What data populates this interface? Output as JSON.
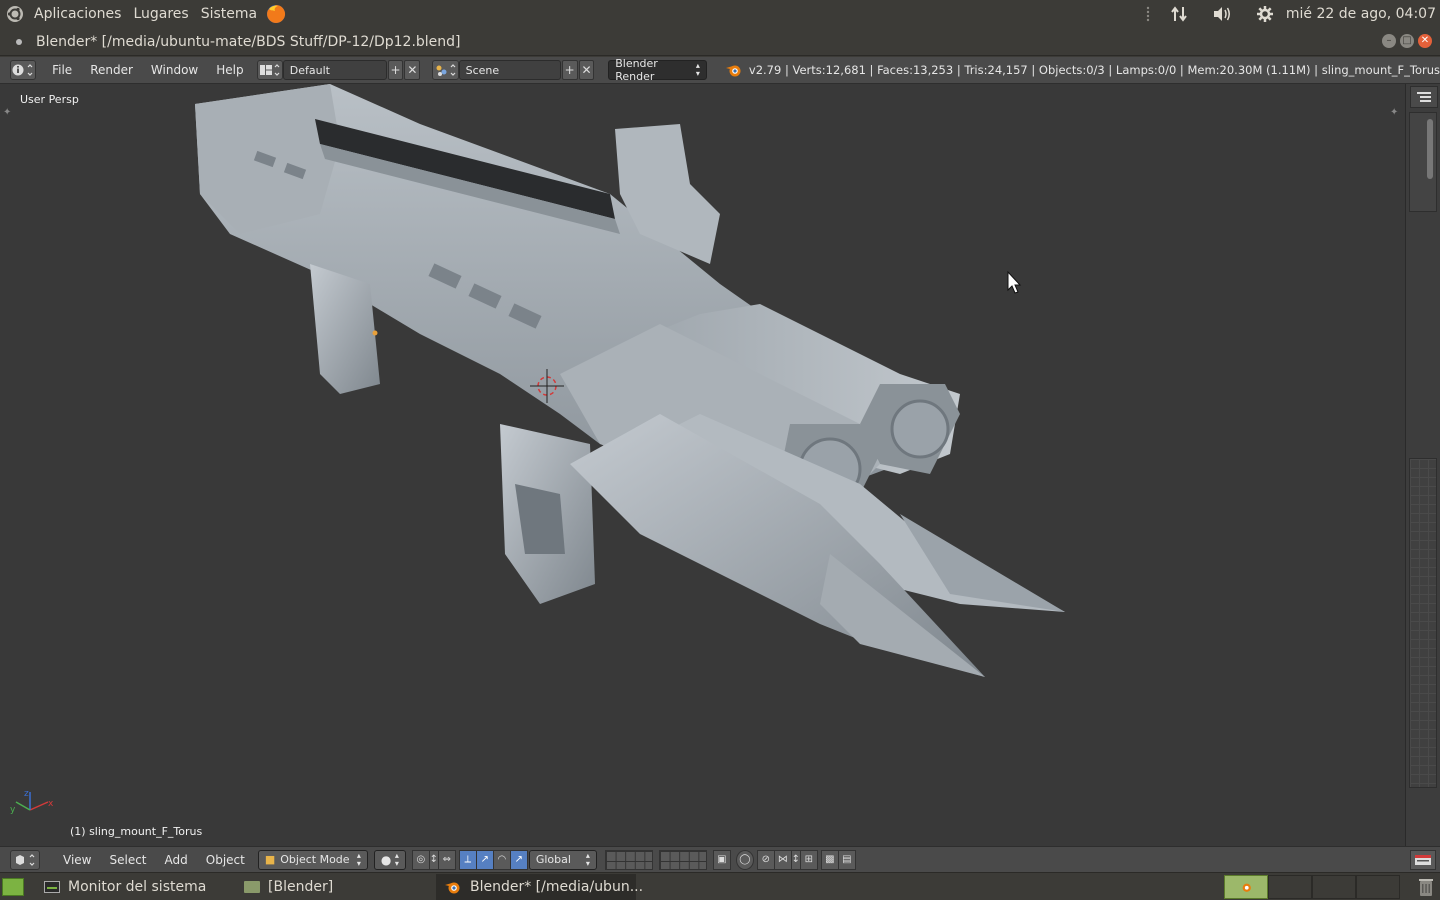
{
  "top_panel": {
    "menus": [
      "Aplicaciones",
      "Lugares",
      "Sistema"
    ],
    "clock": "mié 22 de ago, 04:07"
  },
  "window": {
    "title": "Blender* [/media/ubuntu-mate/BDS Stuff/DP-12/Dp12.blend]"
  },
  "info_header": {
    "menus": [
      "File",
      "Render",
      "Window",
      "Help"
    ],
    "layout": "Default",
    "scene": "Scene",
    "engine": "Blender Render",
    "stats": "v2.79 | Verts:12,681 | Faces:13,253 | Tris:24,157 | Objects:0/3 | Lamps:0/0 | Mem:20.30M (1.11M) | sling_mount_F_Torus"
  },
  "viewport": {
    "view_label": "User Persp",
    "object_label": "(1) sling_mount_F_Torus"
  },
  "view_header": {
    "menus": [
      "View",
      "Select",
      "Add",
      "Object"
    ],
    "mode": "Object Mode",
    "orientation": "Global"
  },
  "taskbar": {
    "tasks": [
      "Monitor del sistema",
      "[Blender]",
      "Blender* [/media/ubun..."
    ]
  },
  "colors": {
    "viewport_bg": "#393939",
    "header_bg": "#4a4a4a",
    "panel_bg": "#3c3b37",
    "close_button": "#e4613a",
    "active_blue": "#5680c2"
  }
}
